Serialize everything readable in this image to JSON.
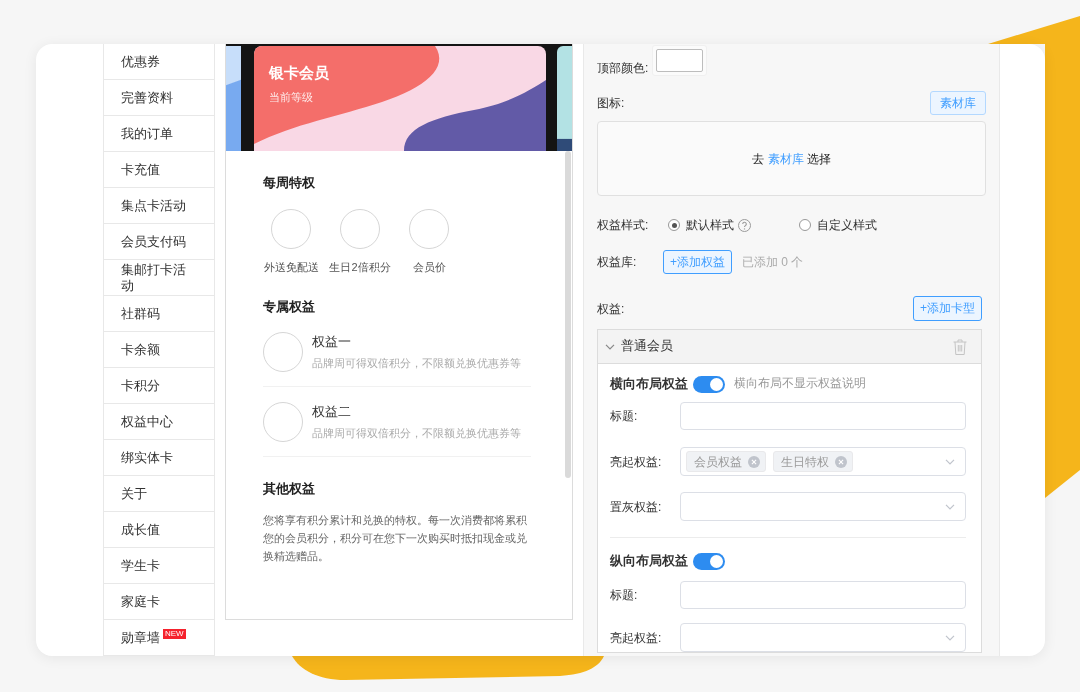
{
  "sidebar": {
    "items": [
      {
        "label": "优惠券",
        "selected": false
      },
      {
        "label": "完善资料",
        "selected": false
      },
      {
        "label": "我的订单",
        "selected": false
      },
      {
        "label": "卡充值",
        "selected": false
      },
      {
        "label": "集点卡活动",
        "selected": false
      },
      {
        "label": "会员支付码",
        "selected": false
      },
      {
        "label": "集邮打卡活动",
        "selected": false
      },
      {
        "label": "社群码",
        "selected": false
      },
      {
        "label": "卡余额",
        "selected": false
      },
      {
        "label": "卡积分",
        "selected": false
      },
      {
        "label": "权益中心",
        "selected": false
      },
      {
        "label": "绑实体卡",
        "selected": false
      },
      {
        "label": "关于",
        "selected": false
      },
      {
        "label": "成长值",
        "selected": false
      },
      {
        "label": "学生卡",
        "selected": false
      },
      {
        "label": "家庭卡",
        "selected": false
      },
      {
        "label": "勋章墙",
        "badge": "NEW",
        "selected": false
      }
    ]
  },
  "preview": {
    "member_card": {
      "title": "银卡会员",
      "subtitle": "当前等级"
    },
    "sections": [
      {
        "kind": "icon_grid",
        "title": "每周特权",
        "items": [
          {
            "label": "外送免配送"
          },
          {
            "label": "生日2倍积分"
          },
          {
            "label": "会员价"
          }
        ]
      },
      {
        "kind": "list",
        "title": "专属权益",
        "items": [
          {
            "title": "权益一",
            "description": "品牌周可得双倍积分，不限额兑换优惠券等"
          },
          {
            "title": "权益二",
            "description": "品牌周可得双倍积分，不限额兑换优惠券等"
          }
        ]
      },
      {
        "kind": "text",
        "title": "其他权益",
        "text": "您将享有积分累计和兑换的特权。每一次消费都将累积您的会员积分，积分可在您下一次购买时抵扣现金或兑换精选赠品。"
      }
    ]
  },
  "settings": {
    "top_color": {
      "label": "顶部颜色:",
      "color": "#ffffff"
    },
    "icon": {
      "label": "图标:",
      "button": "素材库",
      "dropzone": {
        "prefix": "去",
        "link": "素材库",
        "suffix": "选择"
      }
    },
    "benefit_style": {
      "label": "权益样式:",
      "options": [
        {
          "label": "默认样式",
          "help": true,
          "selected": true
        },
        {
          "label": "自定义样式",
          "selected": false
        }
      ]
    },
    "benefit_library": {
      "label": "权益库:",
      "button": "+添加权益",
      "count": "已添加 0 个"
    },
    "benefits": {
      "label": "权益:",
      "button": "+添加卡型",
      "panels": [
        {
          "title": "普通会员",
          "expanded": true,
          "groups": [
            {
              "label": "横向布局权益",
              "on": true,
              "hint": "横向布局不显示权益说明",
              "fields": [
                {
                  "kind": "input",
                  "label": "标题:"
                },
                {
                  "kind": "select",
                  "label": "亮起权益:",
                  "tags": [
                    "会员权益",
                    "生日特权"
                  ]
                },
                {
                  "kind": "select",
                  "label": "置灰权益:"
                }
              ]
            },
            {
              "label": "纵向布局权益",
              "on": true,
              "fields": [
                {
                  "kind": "input",
                  "label": "标题:"
                },
                {
                  "kind": "select",
                  "label": "亮起权益:"
                }
              ]
            }
          ]
        }
      ]
    }
  }
}
